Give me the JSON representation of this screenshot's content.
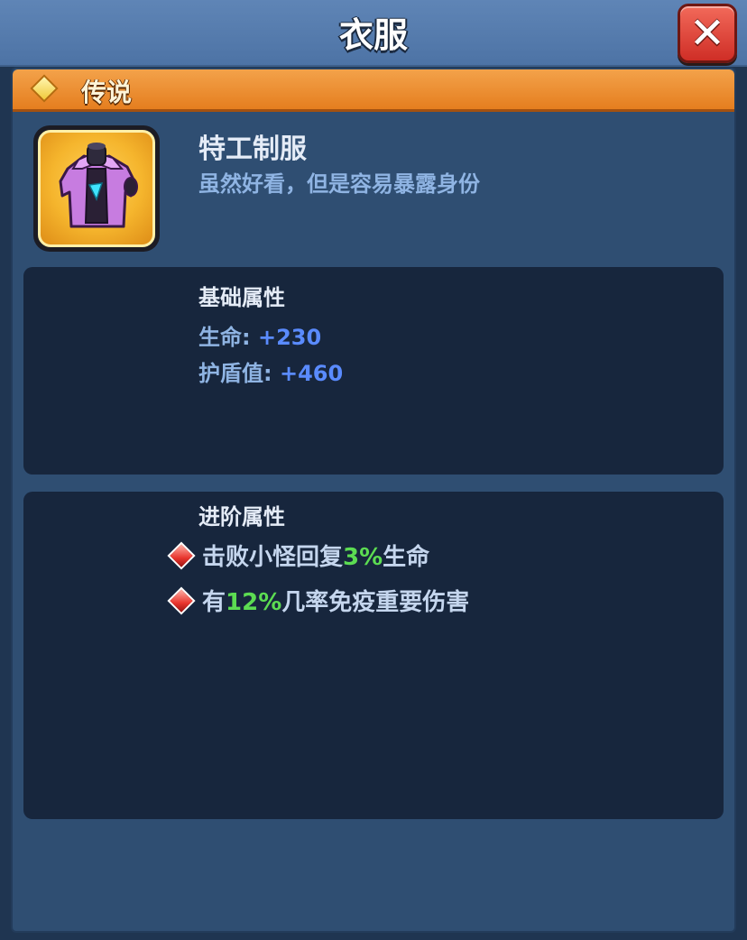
{
  "window": {
    "title": "衣服",
    "close_icon": "close-icon"
  },
  "rarity": {
    "label": "传说",
    "icon": "diamond-icon",
    "color": "#ef8f2b"
  },
  "item": {
    "name": "特工制服",
    "description": "虽然好看，但是容易暴露身份",
    "icon": "jacket-icon"
  },
  "base_stats": {
    "title": "基础属性",
    "lines": [
      {
        "label": "生命: ",
        "value": "+230"
      },
      {
        "label": "护盾值: ",
        "value": "+460"
      }
    ]
  },
  "advanced_stats": {
    "title": "进阶属性",
    "bullet_icon": "red-gem-icon",
    "lines": [
      {
        "before": "击败小怪回复",
        "highlight": "3%",
        "after": "生命"
      },
      {
        "before": "有",
        "highlight": "12%",
        "after": "几率免疫重要伤害"
      }
    ]
  },
  "colors": {
    "header": "#5a80b1",
    "rarity_bar": "#ef8f2b",
    "stat_value": "#5a8bff",
    "highlight": "#5cdc52",
    "close_button": "#e0483d"
  }
}
